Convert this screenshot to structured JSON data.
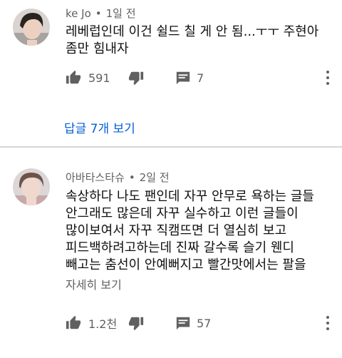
{
  "comments": [
    {
      "author": "ke Jo",
      "separator": "•",
      "time": "1일 전",
      "lines": [
        "레베럽인데 이건 쉴드 칠 게 안 됨...ㅜㅜ 주현아",
        "좀만 힘내자"
      ],
      "likes": "591",
      "reply_count": "7",
      "view_replies": "답글 7개 보기"
    },
    {
      "author": "아바타스타슈",
      "separator": "•",
      "time": "2일 전",
      "lines": [
        "속상하다 나도 팬인데 자꾸 안무로 욕하는 글들",
        "안그래도 많은데 자꾸 실수하고 이런 글들이",
        "많이보여서 자꾸 직캠뜨면 더 열심히 보고",
        "피드백하려고하는데 진짜 갈수록 슬기 웬디",
        "빼고는 춤선이 안예뻐지고 빨간맛에서는 팔을"
      ],
      "read_more": "자세히 보기",
      "likes": "1.2천",
      "reply_count": "57"
    }
  ],
  "icons": {
    "like": "thumbs-up-icon",
    "dislike": "thumbs-down-icon",
    "reply": "comment-icon",
    "more": "more-vertical-icon"
  },
  "colors": {
    "link_blue": "#065fd4",
    "meta_gray": "#606060",
    "icon_gray": "#606060",
    "divider": "#d6d6d6"
  }
}
